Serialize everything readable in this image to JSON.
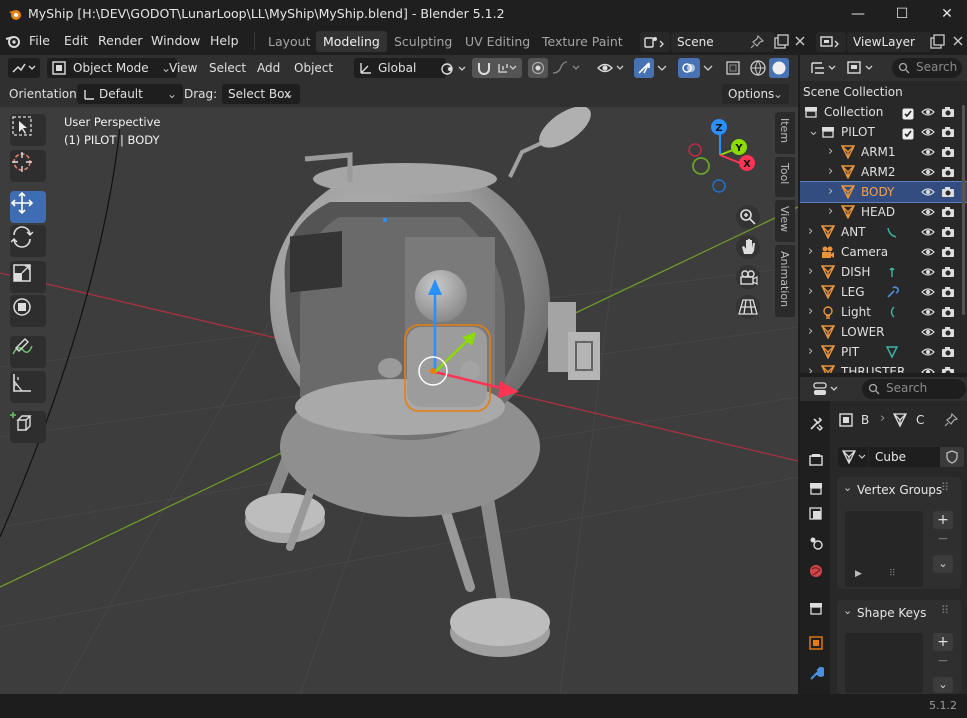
{
  "window": {
    "title": "MyShip [H:\\DEV\\GODOT\\LunarLoop\\LL\\MyShip\\MyShip.blend] - Blender 5.1.2",
    "minimize": "—",
    "maximize": "☐",
    "close": "✕"
  },
  "menu": {
    "items": [
      "File",
      "Edit",
      "Render",
      "Window",
      "Help"
    ],
    "workspaces": [
      {
        "label": "Layout",
        "active": false
      },
      {
        "label": "Modeling",
        "active": true
      },
      {
        "label": "Sculpting",
        "active": false
      },
      {
        "label": "UV Editing",
        "active": false
      },
      {
        "label": "Texture Paint",
        "active": false
      }
    ],
    "scene": "Scene",
    "view_layer": "ViewLayer"
  },
  "viewport_header": {
    "mode": "Object Mode",
    "menus": [
      "View",
      "Select",
      "Add",
      "Object"
    ],
    "transform_orientation": "Global",
    "orientation_label": "Orientation:",
    "orientation_value": "Default",
    "drag_label": "Drag:",
    "drag_value": "Select Box",
    "options": "Options"
  },
  "viewport": {
    "perspective": "User Perspective",
    "active_object": "(1) PILOT | BODY",
    "gizmo_labels": {
      "z": "Z",
      "y": "Y",
      "x": "X"
    },
    "n_tabs": [
      "Item",
      "Tool",
      "View",
      "Animation"
    ]
  },
  "outliner": {
    "search_placeholder": "Search",
    "root": "Scene Collection",
    "rows": [
      {
        "label": "Collection",
        "indent": 0,
        "kind": "collection",
        "selected": false
      },
      {
        "label": "PILOT",
        "indent": 1,
        "kind": "collection",
        "selected": false
      },
      {
        "label": "ARM1",
        "indent": 2,
        "kind": "mesh",
        "selected": false
      },
      {
        "label": "ARM2",
        "indent": 2,
        "kind": "mesh",
        "selected": false
      },
      {
        "label": "BODY",
        "indent": 2,
        "kind": "mesh",
        "selected": true
      },
      {
        "label": "HEAD",
        "indent": 2,
        "kind": "mesh",
        "selected": false
      },
      {
        "label": "ANT",
        "indent": 1,
        "kind": "mesh",
        "selected": false
      },
      {
        "label": "Camera",
        "indent": 1,
        "kind": "camera",
        "selected": false
      },
      {
        "label": "DISH",
        "indent": 1,
        "kind": "mesh",
        "selected": false
      },
      {
        "label": "LEG",
        "indent": 1,
        "kind": "mesh",
        "selected": false
      },
      {
        "label": "Light",
        "indent": 1,
        "kind": "light",
        "selected": false
      },
      {
        "label": "LOWER",
        "indent": 1,
        "kind": "mesh",
        "selected": false
      },
      {
        "label": "PIT",
        "indent": 1,
        "kind": "mesh",
        "selected": false
      },
      {
        "label": "THRUSTER",
        "indent": 1,
        "kind": "mesh",
        "selected": false
      }
    ]
  },
  "properties": {
    "search_placeholder": "Search",
    "breadcrumb_a": "B",
    "breadcrumb_b": "C",
    "mesh_name": "Cube",
    "vertex_groups": "Vertex Groups",
    "shape_keys": "Shape Keys"
  },
  "status": {
    "version": "5.1.2"
  },
  "colors": {
    "accent": "#4772b3",
    "selection": "#e87d0d",
    "x_axis": "#ff3352",
    "y_axis": "#8bdc00",
    "z_axis": "#2890ff"
  }
}
